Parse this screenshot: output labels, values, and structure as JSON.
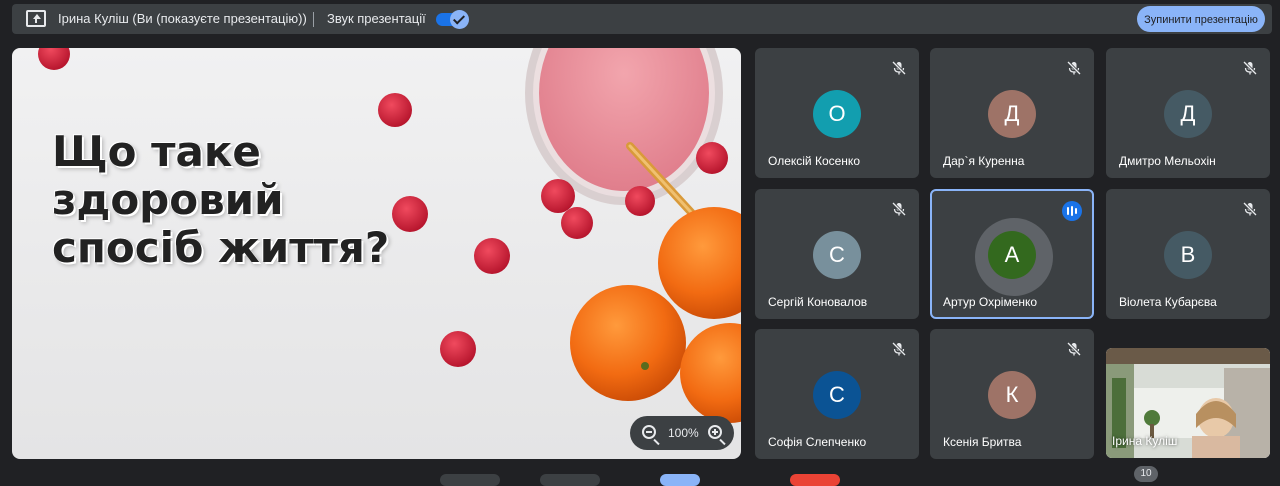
{
  "topbar": {
    "presenter_text": "Ірина Куліш (Ви (показуєте презентацію))",
    "sound_label": "Звук презентації",
    "sound_enabled": true,
    "stop_button": "Зупинити презентацію"
  },
  "slide": {
    "title_lines": [
      "Що таке",
      "здоровий",
      "спосіб життя?"
    ],
    "zoom_level": "100%"
  },
  "participants": [
    {
      "name": "Олексій Косенко",
      "initial": "О",
      "color": "#129eaf",
      "muted": true,
      "speaking": false
    },
    {
      "name": "Дар`я Куренна",
      "initial": "Д",
      "color": "#9e7367",
      "muted": true,
      "speaking": false
    },
    {
      "name": "Дмитро Мельохін",
      "initial": "Д",
      "color": "#455a64",
      "muted": true,
      "speaking": false
    },
    {
      "name": "Сергій Коновалов",
      "initial": "С",
      "color": "#78909c",
      "muted": true,
      "speaking": false
    },
    {
      "name": "Артур Охріменко",
      "initial": "А",
      "color": "#33691e",
      "muted": false,
      "speaking": true
    },
    {
      "name": "Віолета Кубарєва",
      "initial": "В",
      "color": "#455a64",
      "muted": true,
      "speaking": false
    },
    {
      "name": "Софія Слепченко",
      "initial": "С",
      "color": "#0b5394",
      "muted": true,
      "speaking": false
    },
    {
      "name": "Ксенія Бритва",
      "initial": "К",
      "color": "#9e7367",
      "muted": true,
      "speaking": false
    }
  ],
  "self_view": {
    "name": "Ірина Куліш"
  },
  "participant_count": "10",
  "colors": {
    "accent": "#8ab4f8",
    "surface": "#3c4043",
    "background": "#202124",
    "primary": "#1a73e8"
  }
}
